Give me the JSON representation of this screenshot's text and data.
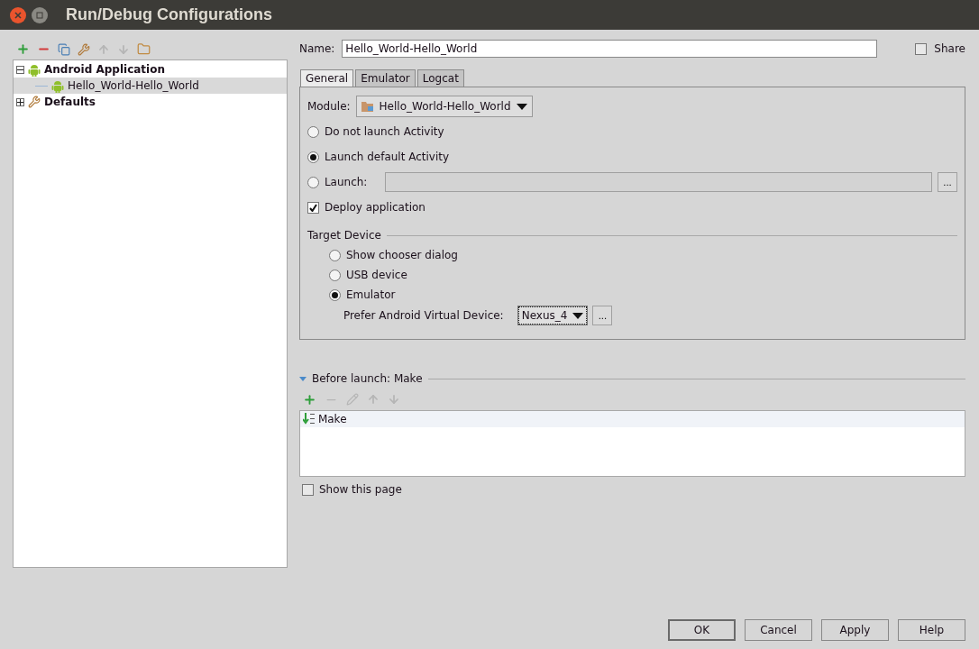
{
  "window": {
    "title": "Run/Debug Configurations"
  },
  "tree": [
    {
      "label": "Android Application",
      "kind": "android",
      "expanded": true,
      "selected": false,
      "children": [
        {
          "label": "Hello_World-Hello_World",
          "kind": "android",
          "selected": true
        }
      ]
    },
    {
      "label": "Defaults",
      "kind": "wrench",
      "expanded": false,
      "selected": false
    }
  ],
  "name": {
    "label": "Name:",
    "value": "Hello_World-Hello_World"
  },
  "share": {
    "label": "Share",
    "checked": false
  },
  "tabs": [
    {
      "label": "General",
      "selected": true
    },
    {
      "label": "Emulator",
      "selected": false
    },
    {
      "label": "Logcat",
      "selected": false
    }
  ],
  "general": {
    "module": {
      "label": "Module:",
      "value": "Hello_World-Hello_World"
    },
    "launch_options": [
      {
        "label": "Do not launch Activity",
        "selected": false,
        "kind": "plain"
      },
      {
        "label": "Launch default Activity",
        "selected": true,
        "kind": "plain"
      },
      {
        "label": "Launch:",
        "selected": false,
        "kind": "field"
      }
    ],
    "launch_browse": "...",
    "deploy": {
      "label": "Deploy application",
      "checked": true
    },
    "target_device": {
      "title": "Target Device",
      "options": [
        {
          "label": "Show chooser dialog",
          "selected": false
        },
        {
          "label": "USB device",
          "selected": false
        },
        {
          "label": "Emulator",
          "selected": true
        }
      ],
      "avd": {
        "label": "Prefer Android Virtual Device:",
        "value": "Nexus_4",
        "browse": "..."
      }
    }
  },
  "before_launch": {
    "title": "Before launch: Make",
    "expanded": true,
    "tasks": [
      {
        "label": "Make"
      }
    ]
  },
  "show_page": {
    "label": "Show this page",
    "checked": false
  },
  "buttons": [
    {
      "label": "OK",
      "default": true
    },
    {
      "label": "Cancel",
      "default": false
    },
    {
      "label": "Apply",
      "default": false
    },
    {
      "label": "Help",
      "default": false
    }
  ]
}
